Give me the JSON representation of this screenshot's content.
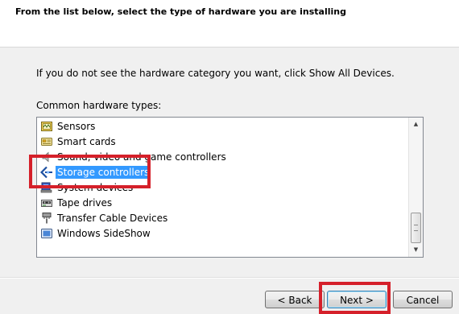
{
  "header": {
    "title": "From the list below, select the type of hardware you are installing"
  },
  "instruction": "If you do not see the hardware category you want, click Show All Devices.",
  "list": {
    "label": "Common hardware types:",
    "items": [
      {
        "label": "Sensors",
        "icon": "sensor-icon"
      },
      {
        "label": "Smart cards",
        "icon": "smart-card-icon"
      },
      {
        "label": "Sound, video and game controllers",
        "icon": "speaker-icon"
      },
      {
        "label": "Storage controllers",
        "icon": "storage-controller-icon",
        "selected": true
      },
      {
        "label": "System devices",
        "icon": "system-device-icon"
      },
      {
        "label": "Tape drives",
        "icon": "tape-drive-icon"
      },
      {
        "label": "Transfer Cable Devices",
        "icon": "transfer-cable-icon"
      },
      {
        "label": "Windows SideShow",
        "icon": "sideshow-icon"
      }
    ]
  },
  "buttons": {
    "back": "< Back",
    "next": "Next >",
    "cancel": "Cancel"
  },
  "colors": {
    "selection": "#3399ff",
    "annotation": "#d5202a",
    "dialog_background": "#f0f0f0"
  }
}
